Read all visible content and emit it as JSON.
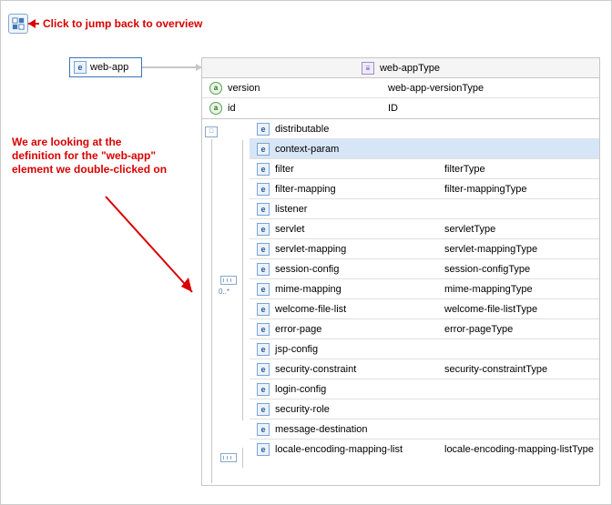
{
  "annotations": {
    "top": "Click to jump back to overview",
    "left": "We are looking at the definition for the \"web-app\" element we double-clicked on"
  },
  "sourceElement": {
    "label": "web-app"
  },
  "typePanel": {
    "title": "web-appType",
    "attributes": [
      {
        "name": "version",
        "type": "web-app-versionType"
      },
      {
        "name": "id",
        "type": "ID"
      }
    ],
    "blocks": [
      {
        "children": [
          {
            "name": "distributable",
            "type": "",
            "selected": false
          },
          {
            "name": "context-param",
            "type": "",
            "selected": true
          },
          {
            "name": "filter",
            "type": "filterType",
            "selected": false
          },
          {
            "name": "filter-mapping",
            "type": "filter-mappingType",
            "selected": false
          },
          {
            "name": "listener",
            "type": "",
            "selected": false
          },
          {
            "name": "servlet",
            "type": "servletType",
            "selected": false
          },
          {
            "name": "servlet-mapping",
            "type": "servlet-mappingType",
            "selected": false
          },
          {
            "name": "session-config",
            "type": "session-configType",
            "selected": false
          },
          {
            "name": "mime-mapping",
            "type": "mime-mappingType",
            "selected": false
          },
          {
            "name": "welcome-file-list",
            "type": "welcome-file-listType",
            "selected": false
          },
          {
            "name": "error-page",
            "type": "error-pageType",
            "selected": false
          },
          {
            "name": "jsp-config",
            "type": "",
            "selected": false
          },
          {
            "name": "security-constraint",
            "type": "security-constraintType",
            "selected": false
          },
          {
            "name": "login-config",
            "type": "",
            "selected": false
          },
          {
            "name": "security-role",
            "type": "",
            "selected": false
          }
        ],
        "occursLabel": "0..*"
      },
      {
        "children": [
          {
            "name": "message-destination",
            "type": "",
            "selected": false
          },
          {
            "name": "locale-encoding-mapping-list",
            "type": "locale-encoding-mapping-listType",
            "selected": false
          }
        ],
        "occursLabel": ""
      }
    ]
  }
}
